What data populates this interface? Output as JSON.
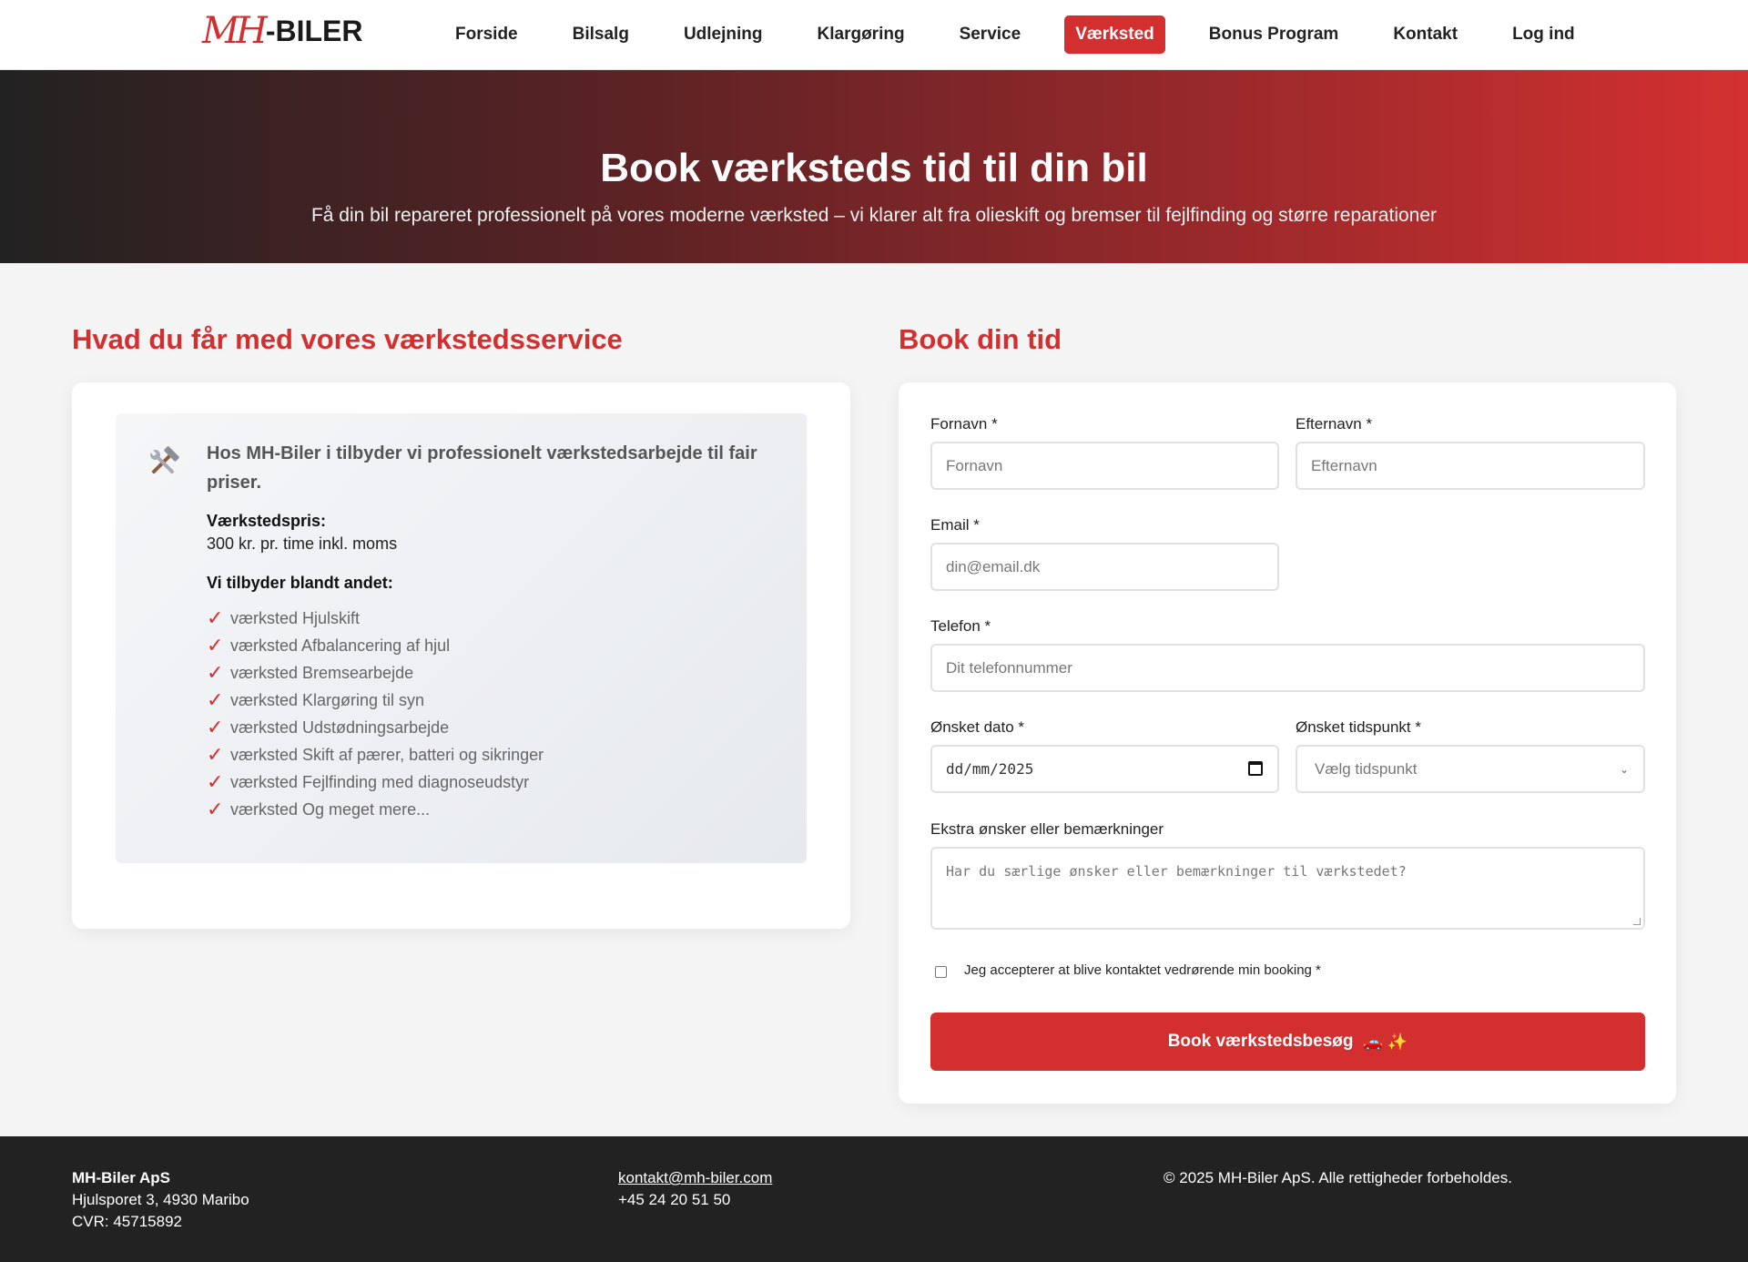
{
  "brand": {
    "logo_mh": "MH",
    "logo_biler": "-BILER"
  },
  "nav": {
    "items": [
      "Forside",
      "Bilsalg",
      "Udlejning",
      "Klargøring",
      "Service",
      "Værksted",
      "Bonus Program",
      "Kontakt",
      "Log ind"
    ],
    "active": "Værksted"
  },
  "hero": {
    "title": "Book værksteds tid til din bil",
    "subtitle": "Få din bil repareret professionelt på vores moderne værksted – vi klarer alt fra olieskift og bremser til fejlfinding og større reparationer"
  },
  "left": {
    "title": "Hvad du får med vores værkstedsservice",
    "intro": "Hos MH-Biler i tilbyder vi professionelt værkstedsarbejde til fair priser.",
    "price_label": "Værkstedspris:",
    "price_value": "300 kr. pr. time inkl. moms",
    "offer_label": "Vi tilbyder blandt andet:",
    "features": [
      "værksted Hjulskift",
      "værksted Afbalancering af hjul",
      "værksted Bremsearbejde",
      "værksted Klargøring til syn",
      "værksted Udstødningsarbejde",
      "værksted Skift af pærer, batteri og sikringer",
      "værksted Fejlfinding med diagnoseudstyr",
      "værksted Og meget mere..."
    ],
    "check_symbol": "✓"
  },
  "form": {
    "title": "Book din tid",
    "firstname_label": "Fornavn *",
    "firstname_placeholder": "Fornavn",
    "lastname_label": "Efternavn *",
    "lastname_placeholder": "Efternavn",
    "email_label": "Email *",
    "email_placeholder": "din@email.dk",
    "phone_label": "Telefon *",
    "phone_placeholder": "Dit telefonnummer",
    "date_label": "Ønsket dato *",
    "date_value": "dd/mm/2025",
    "time_label": "Ønsket tidspunkt *",
    "time_value": "Vælg tidspunkt",
    "notes_label": "Ekstra ønsker eller bemærkninger",
    "notes_placeholder": "Har du særlige ønsker eller bemærkninger til værkstedet?",
    "consent_label": "Jeg accepterer at blive kontaktet vedrørende min booking *",
    "submit_label": "Book værkstedsbesøg",
    "submit_emoji": "🚗 ✨"
  },
  "footer": {
    "company": "MH-Biler ApS",
    "address": "Hjulsporet 3, 4930 Maribo",
    "cvr": "CVR: 45715892",
    "email": "kontakt@mh-biler.com",
    "phone": "+45 24 20 51 50",
    "copyright": "© 2025 MH-Biler ApS. Alle rettigheder forbeholdes."
  },
  "colors": {
    "accent": "#d32f2f",
    "dark": "#222222",
    "card": "#ffffff",
    "page_bg": "#f4f4f5"
  },
  "icons": {
    "tools": "hammer-wrench-icon",
    "calendar": "calendar-icon",
    "select": "chevron-down-icon"
  }
}
